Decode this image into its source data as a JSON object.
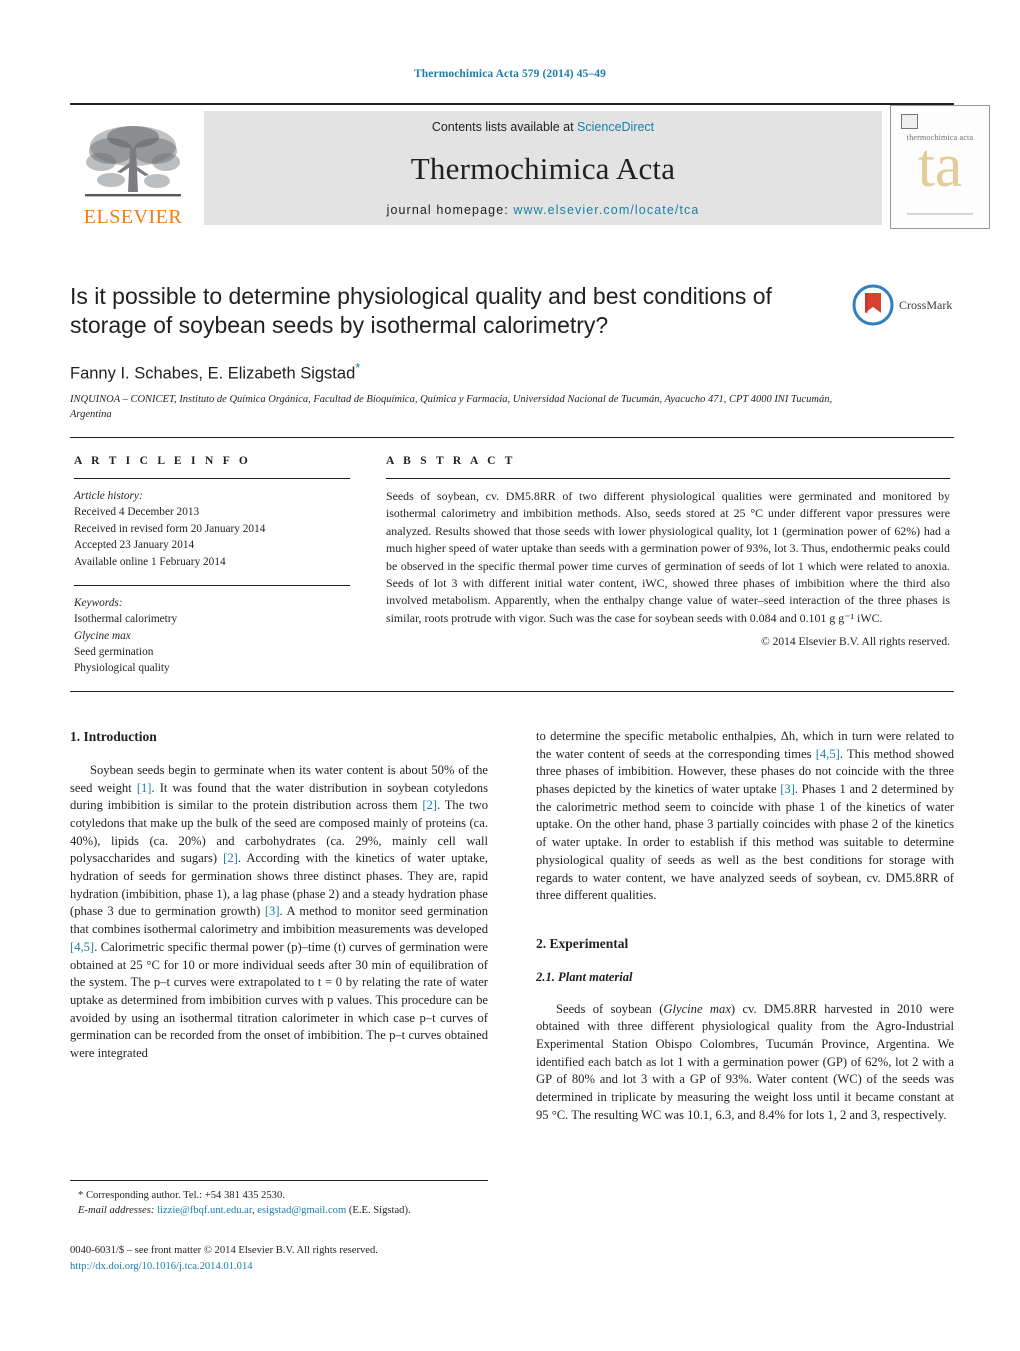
{
  "running_head": "Thermochimica Acta 579 (2014) 45–49",
  "masthead": {
    "publisher_name": "ELSEVIER",
    "contents_prefix": "Contents lists available at ",
    "contents_link": "ScienceDirect",
    "journal_name": "Thermochimica Acta",
    "homepage_prefix": "journal homepage: ",
    "homepage_url": "www.elsevier.com/locate/tca",
    "cover_title": "thermochimica acta",
    "cover_monogram": "ta"
  },
  "article": {
    "title": "Is it possible to determine physiological quality and best conditions of storage of soybean seeds by isothermal calorimetry?",
    "crossmark_label": "CrossMark",
    "authors": "Fanny I. Schabes, E. Elizabeth Sigstad",
    "author_star": "*",
    "affiliation": "INQUINOA – CONICET, Instituto de Química Orgánica, Facultad de Bioquímica, Química y Farmacia, Universidad Nacional de Tucumán, Ayacucho 471, CPT 4000 INI Tucumán, Argentina"
  },
  "article_info": {
    "heading": "A R T I C L E    I N F O",
    "history_label": "Article history:",
    "history": [
      "Received 4 December 2013",
      "Received in revised form 20 January 2014",
      "Accepted 23 January 2014",
      "Available online 1 February 2014"
    ],
    "keywords_label": "Keywords:",
    "keywords": [
      "Isothermal calorimetry",
      "Glycine max",
      "Seed germination",
      "Physiological quality"
    ]
  },
  "abstract": {
    "heading": "A B S T R A C T",
    "text": "Seeds of soybean, cv. DM5.8RR of two different physiological qualities were germinated and monitored by isothermal calorimetry and imbibition methods. Also, seeds stored at 25 °C under different vapor pressures were analyzed. Results showed that those seeds with lower physiological quality, lot 1 (germination power of 62%) had a much higher speed of water uptake than seeds with a germination power of 93%, lot 3. Thus, endothermic peaks could be observed in the specific thermal power time curves of germination of seeds of lot 1 which were related to anoxia. Seeds of lot 3 with different initial water content, iWC, showed three phases of imbibition where the third also involved metabolism. Apparently, when the enthalpy change value of water–seed interaction of the three phases is similar, roots protrude with vigor. Such was the case for soybean seeds with 0.084 and 0.101 g g⁻¹ iWC.",
    "copyright": "© 2014 Elsevier B.V. All rights reserved."
  },
  "sections": {
    "introduction_heading": "1.  Introduction",
    "experimental_heading": "2.  Experimental",
    "plant_material_heading": "2.1.  Plant material"
  },
  "body": {
    "intro_p1_a": "Soybean seeds begin to germinate when its water content is about 50% of the seed weight ",
    "ref1": "[1]",
    "intro_p1_b": ". It was found that the water distribution in soybean cotyledons during imbibition is similar to the protein distribution across them ",
    "ref2a": "[2]",
    "intro_p1_c": ". The two cotyledons that make up the bulk of the seed are composed mainly of proteins (ca. 40%), lipids (ca. 20%) and carbohydrates (ca. 29%, mainly cell wall polysaccharides and sugars) ",
    "ref2b": "[2]",
    "intro_p1_d": ". According with the kinetics of water uptake, hydration of seeds for germination shows three distinct phases. They are, rapid hydration (imbibition, phase 1), a lag phase (phase 2) and a steady hydration phase (phase 3 due to germination growth) ",
    "ref3a": "[3]",
    "intro_p1_e": ". A method to monitor seed germination that combines isothermal calorimetry and imbibition measurements was developed ",
    "ref45a": "[4,5]",
    "intro_p1_f": ". Calorimetric specific thermal power (p)–time (t) curves of germination were obtained at 25 °C for 10 or more individual seeds after 30 min of equilibration of the system. The p–t curves were extrapolated to t = 0 by relating the rate of water uptake as determined from imbibition curves with p values. This procedure can be avoided by using an isothermal titration calorimeter in which case p–t curves of germination can be recorded from the onset of imbibition. The p–t curves obtained were integrated ",
    "intro_p2_a": "to determine the specific metabolic enthalpies, Δh, which in turn were related to the water content of seeds at the corresponding times ",
    "ref45b": "[4,5]",
    "intro_p2_b": ". This method showed three phases of imbibition. However, these phases do not coincide with the three phases depicted by the kinetics of water uptake ",
    "ref3b": "[3]",
    "intro_p2_c": ". Phases 1 and 2 determined by the calorimetric method seem to coincide with phase 1 of the kinetics of water uptake. On the other hand, phase 3 partially coincides with phase 2 of the kinetics of water uptake. In order to establish if this method was suitable to determine physiological quality of seeds as well as the best conditions for storage with regards to water content, we have analyzed seeds of soybean, cv. DM5.8RR of three different qualities.",
    "plant_p1_a": "Seeds of soybean (",
    "plant_italic": "Glycine max",
    "plant_p1_b": ") cv. DM5.8RR harvested in 2010 were obtained with three different physiological quality from the Agro-Industrial Experimental Station Obispo Colombres, Tucumán Province, Argentina. We identified each batch as lot 1 with a germination power (GP) of 62%, lot 2 with a GP of 80% and lot 3 with a GP of 93%. Water content (WC) of the seeds was determined in triplicate by measuring the weight loss until it became constant at 95 °C. The resulting WC was 10.1, 6.3, and 8.4% for lots 1, 2 and 3, respectively."
  },
  "footnote": {
    "star": "*",
    "corresponding": " Corresponding author. Tel.: +54 381 435 2530.",
    "email_label": "E-mail addresses:",
    "email1": "lizzie@fbqf.unt.edu.ar",
    "email2": "esigstad@gmail.com",
    "email_owner": " (E.E. Sigstad)."
  },
  "imprint": {
    "issn_line": "0040-6031/$ – see front matter © 2014 Elsevier B.V. All rights reserved.",
    "doi": "http://dx.doi.org/10.1016/j.tca.2014.01.014"
  }
}
